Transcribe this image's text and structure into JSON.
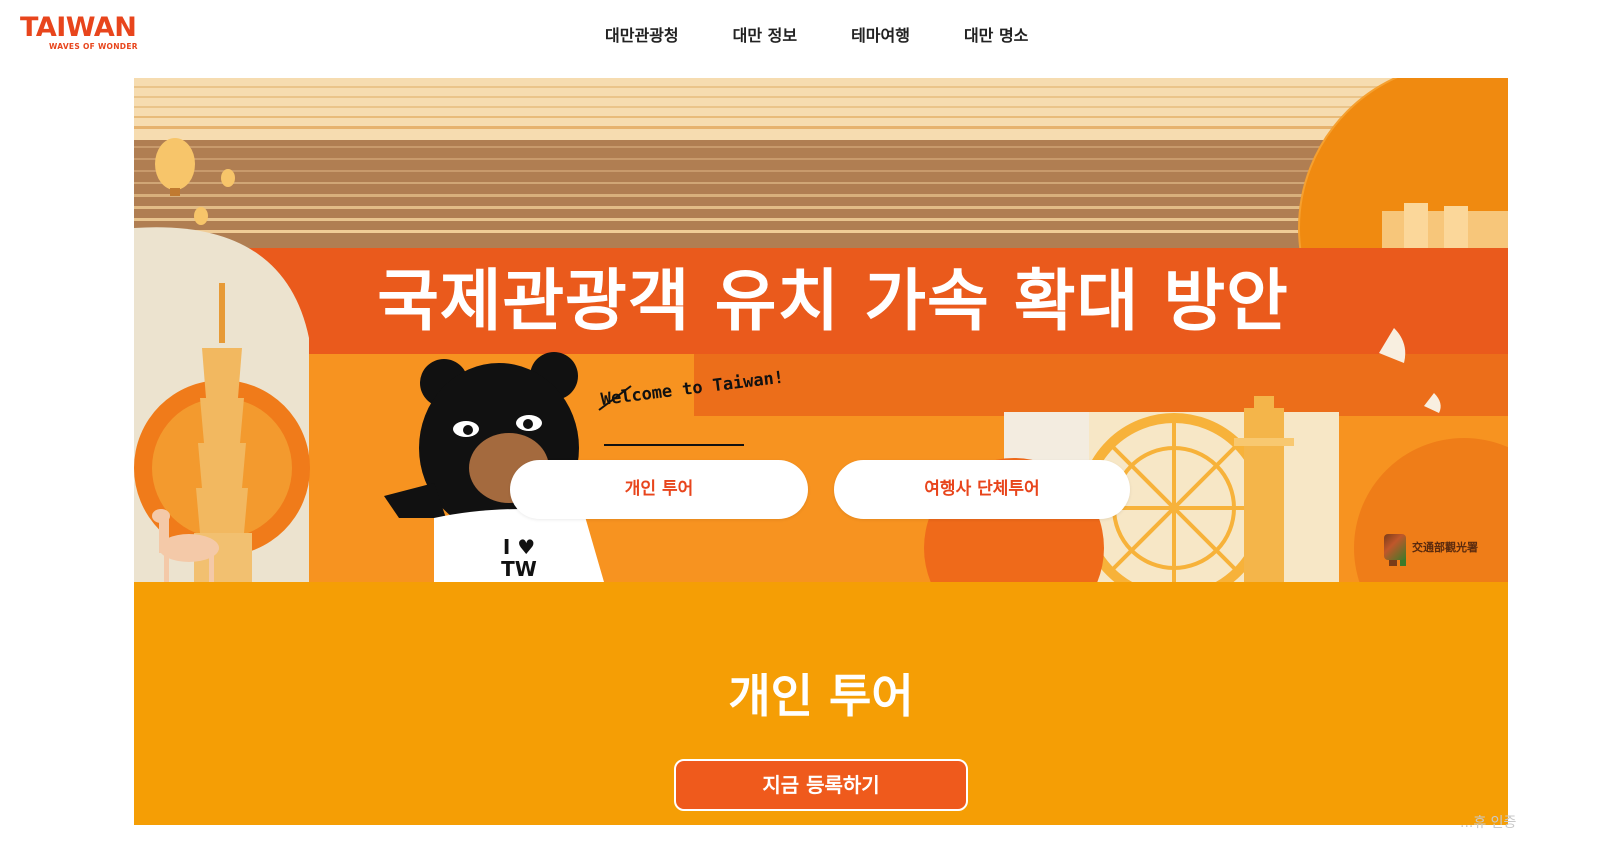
{
  "header": {
    "logo_text": "TAIWAN",
    "logo_tagline": "WAVES OF WONDER",
    "nav": [
      {
        "label": "대만관광청"
      },
      {
        "label": "대만 정보"
      },
      {
        "label": "테마여행"
      },
      {
        "label": "대만 명소"
      }
    ]
  },
  "hero": {
    "headline": "국제관광객 유치 가속 확대 방안",
    "welcome": "Welcome to Taiwan!",
    "shirt_text": "I ♥ TW",
    "buttons": [
      {
        "label": "개인 투어"
      },
      {
        "label": "여행사 단체투어"
      }
    ],
    "agency_logo_text": "交通部觀光署"
  },
  "section": {
    "title": "개인 투어",
    "register_label": "지금 등록하기"
  },
  "corner_note": "...휴 인증",
  "colors": {
    "brand": "#e8451c",
    "hero_orange": "#f7a422",
    "section_orange": "#f59e05",
    "button_orange": "#ef5a1c"
  }
}
